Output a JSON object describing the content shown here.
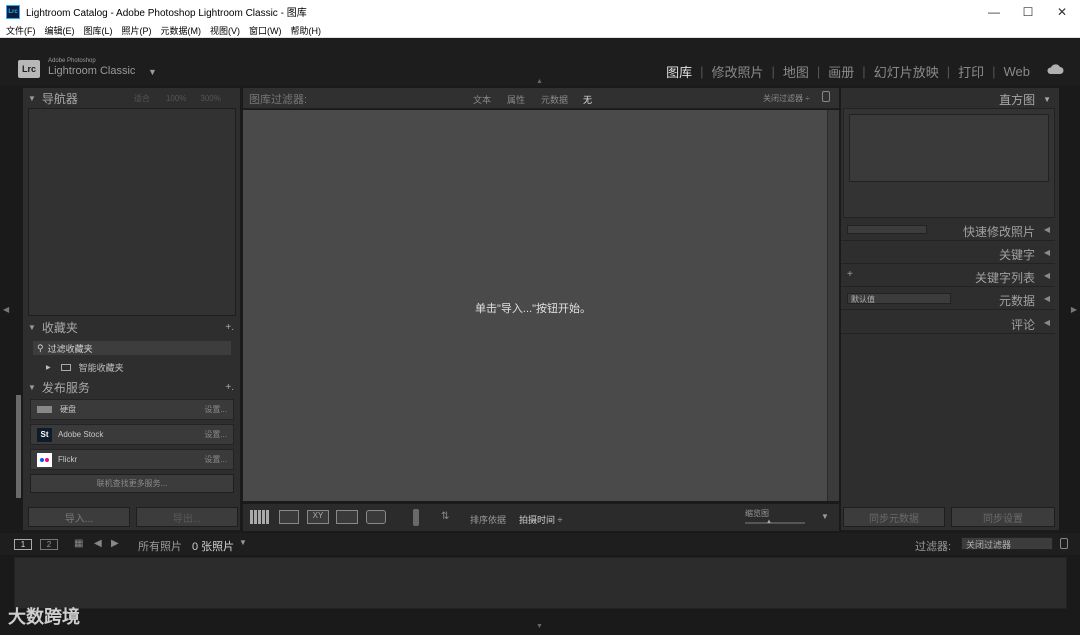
{
  "window": {
    "title": "Lightroom Catalog - Adobe Photoshop Lightroom Classic - 图库",
    "app_icon": "Lrc"
  },
  "menu": [
    "文件(F)",
    "编辑(E)",
    "图库(L)",
    "照片(P)",
    "元数据(M)",
    "视图(V)",
    "窗口(W)",
    "帮助(H)"
  ],
  "brand": {
    "logo": "Lrc",
    "small": "Adobe Photoshop",
    "big": "Lightroom Classic",
    "caret": "▼"
  },
  "modules": [
    "图库",
    "修改照片",
    "地图",
    "画册",
    "幻灯片放映",
    "打印",
    "Web"
  ],
  "left": {
    "navigator": {
      "title": "导航器",
      "zoom_fit": "适合",
      "zoom_100": "100%",
      "zoom_300": "300%"
    },
    "collections": {
      "title": "收藏夹",
      "plus": "+.",
      "filter_item": "过滤收藏夹",
      "smart_item": "智能收藏夹"
    },
    "publish": {
      "title": "发布服务",
      "plus": "+.",
      "services": [
        {
          "icon": "St",
          "name": "硬盘",
          "setting": "设置..."
        },
        {
          "icon": "St",
          "name": "Adobe Stock",
          "setting": "设置..."
        },
        {
          "icon": "flickr",
          "name": "Flickr",
          "setting": "设置..."
        }
      ],
      "find_more": "联机查找更多服务..."
    },
    "import_btn": "导入...",
    "export_btn": "导出..."
  },
  "filter_bar": {
    "title": "图库过滤器:",
    "tabs": [
      "文本",
      "属性",
      "元数据",
      "无"
    ],
    "close": "关闭过滤器 ÷"
  },
  "grid": {
    "empty_message": "单击\"导入...\"按钮开始。"
  },
  "toolbar": {
    "sort_label": "排序依据",
    "sort_value": "拍摄时间 ÷",
    "thumb_label": "缩览图"
  },
  "right": {
    "histogram": "直方图",
    "quick_develop": "快速修改照片",
    "keywording": "关键字",
    "keyword_list": "关键字列表",
    "metadata": "元数据",
    "metadata_preset": "默认值",
    "comments": "评论",
    "sync_metadata": "同步元数据",
    "sync_settings": "同步设置"
  },
  "filmstrip": {
    "page1": "1",
    "page2": "2",
    "source": "所有照片",
    "count": "0 张照片",
    "filter_label": "过滤器:",
    "filter_value": "关闭过滤器"
  },
  "watermark": "大数跨境"
}
